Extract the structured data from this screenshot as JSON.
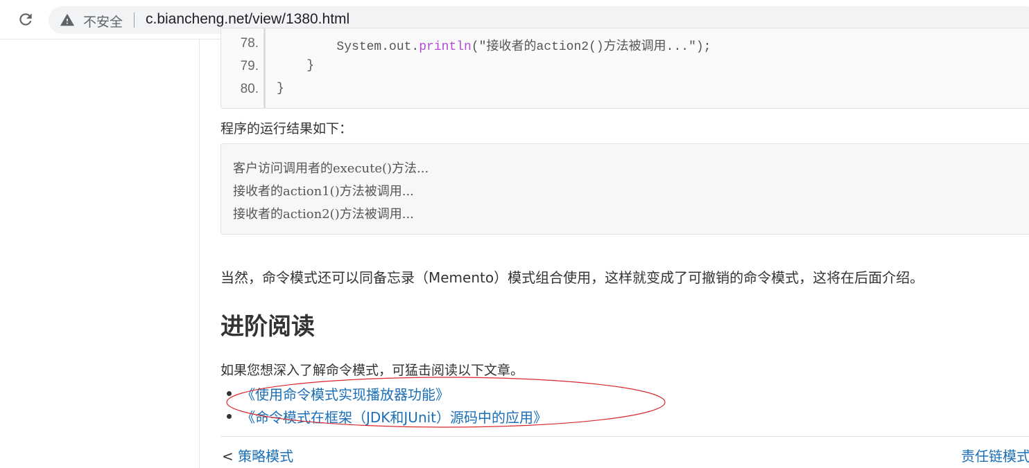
{
  "browser": {
    "security_label": "不安全",
    "url": "c.biancheng.net/view/1380.html"
  },
  "code": {
    "lines": [
      {
        "num": "78.",
        "pre": "        System.out.",
        "kw": "println",
        "post": "(\"接收者的action2()方法被调用...\");"
      },
      {
        "num": "79.",
        "text": "    }"
      },
      {
        "num": "80.",
        "text": "}"
      }
    ]
  },
  "result_label": "程序的运行结果如下：",
  "output": [
    "客户访问调用者的execute()方法...",
    "接收者的action1()方法被调用...",
    "接收者的action2()方法被调用..."
  ],
  "paragraph": "当然，命令模式还可以同备忘录（Memento）模式组合使用，这样就变成了可撤销的命令模式，这将在后面介绍。",
  "heading": "进阶阅读",
  "intro": "如果您想深入了解命令模式，可猛击阅读以下文章。",
  "links": [
    "《使用命令模式实现播放器功能》",
    "《命令模式在框架（JDK和JUnit）源码中的应用》"
  ],
  "nav": {
    "prev_arrow": "<",
    "prev_label": "策略模式",
    "next_label": "责任链模式"
  },
  "colors": {
    "link": "#1a6fb8",
    "annotation": "#d9262b",
    "keyword": "#b04bd6"
  }
}
